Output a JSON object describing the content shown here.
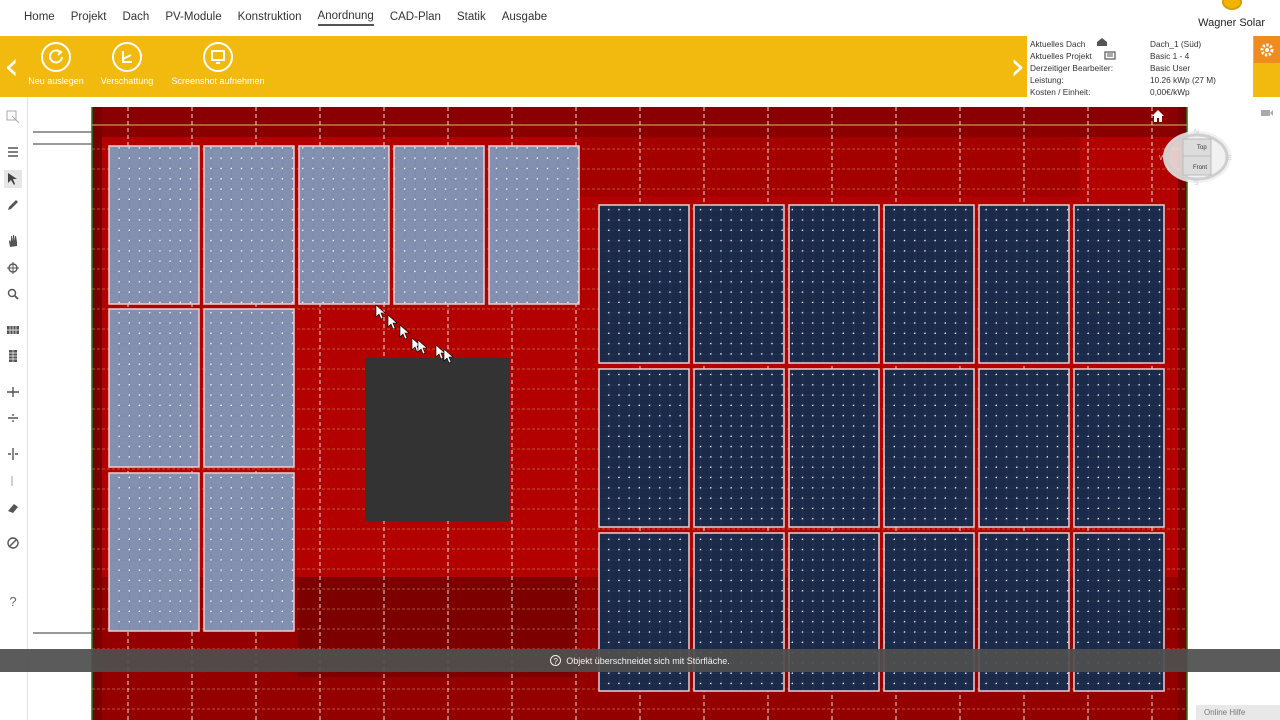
{
  "nav": {
    "items": [
      "Home",
      "Projekt",
      "Dach",
      "PV-Module",
      "Konstruktion",
      "Anordnung",
      "CAD-Plan",
      "Statik",
      "Ausgabe"
    ],
    "active": "Anordnung"
  },
  "brand": {
    "name": "Wagner Solar"
  },
  "toolbar": {
    "buttons": [
      {
        "label": "Neu auslegen",
        "icon": "refresh-icon"
      },
      {
        "label": "Verschattung",
        "icon": "shading-icon"
      },
      {
        "label": "Screenshot aufnehmen",
        "icon": "monitor-icon"
      }
    ],
    "accent_color": "#f2b90f"
  },
  "info": {
    "aktuelles_dach_label": "Aktuelles Dach",
    "aktuelles_dach_value": "Dach_1 (Süd)",
    "aktuelles_projekt_label": "Aktuelles Projekt",
    "aktuelles_projekt_value": "Basic 1 - 4",
    "bearbeiter_label": "Derzeitiger Bearbeiter:",
    "bearbeiter_value": "Basic User",
    "leistung_label": "Leistung:",
    "leistung_value": "10.26 kWp (27 M)",
    "kosten_label": "Kosten / Einheit:",
    "kosten_value": "0,00€/kWp"
  },
  "sidebar": {
    "tools": [
      "select-icon",
      "list-icon",
      "pointer-icon",
      "pencil-icon",
      "hand-icon",
      "rotate-icon",
      "zoom-icon",
      "grid-row-icon",
      "grid-col-icon",
      "distribute-horizontal-icon",
      "distribute-vertical-icon",
      "split-icon",
      "align-icon",
      "eraser-icon",
      "measure-icon",
      "help-icon"
    ],
    "help_label": "?"
  },
  "compass": {
    "top": "Top",
    "front": "Front",
    "n": "N",
    "s": "S",
    "w": "W",
    "e": "E"
  },
  "notification": {
    "text": "Objekt überschneidet sich mit Störfläche."
  },
  "help_tab": {
    "label": "Online Hilfe"
  },
  "colors": {
    "roof": "#b30000",
    "roof_dark": "#8a0000",
    "module_light": "#7a87a8",
    "module_dark": "#1c2a4a",
    "obstacle": "#333333",
    "gear": "#f08c1e"
  }
}
